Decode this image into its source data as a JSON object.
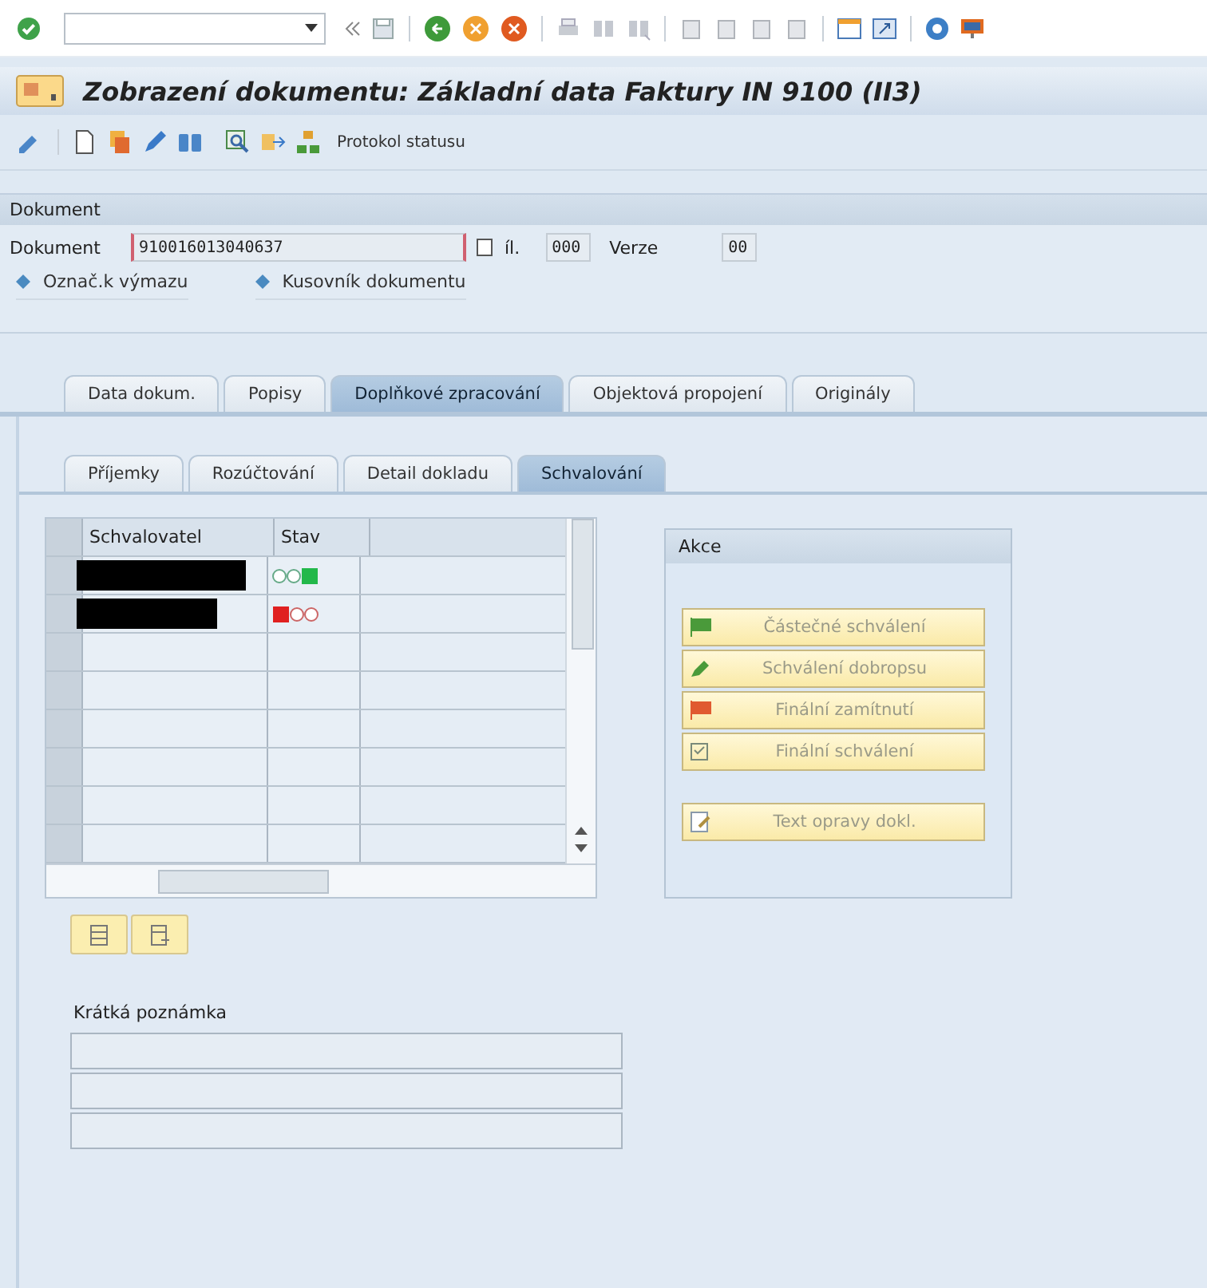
{
  "window": {
    "title": "Zobrazení dokumentu: Základní data Faktury IN 9100 (II3)"
  },
  "app_toolbar": {
    "button": "Protokol statusu"
  },
  "document": {
    "section_title": "Dokument",
    "field_label": "Dokument",
    "field_value": "910016013040637",
    "part_label": "íl.",
    "part_value": "000",
    "version_label": "Verze",
    "version_value": "00",
    "links": [
      "Označ.k výmazu",
      "Kusovník dokumentu"
    ]
  },
  "tabs": [
    {
      "label": "Data dokum.",
      "selected": false
    },
    {
      "label": "Popisy",
      "selected": false
    },
    {
      "label": "Doplňkové zpracování",
      "selected": true
    },
    {
      "label": "Objektová propojení",
      "selected": false
    },
    {
      "label": "Originály",
      "selected": false
    }
  ],
  "subtabs": [
    {
      "label": "Příjemky",
      "selected": false
    },
    {
      "label": "Rozúčtování",
      "selected": false
    },
    {
      "label": "Detail dokladu",
      "selected": false
    },
    {
      "label": "Schvalování",
      "selected": true
    }
  ],
  "approvers": {
    "columns": [
      "Schvalovatel",
      "Stav"
    ],
    "rows": [
      {
        "kind": "go",
        "color": "#22b84a"
      },
      {
        "kind": "stop",
        "color": "#e02020"
      }
    ]
  },
  "actions": {
    "title": "Akce",
    "buttons": [
      {
        "label": "Částečné schválení",
        "kind": "flag",
        "color": "#4a9a3a",
        "disabled": true
      },
      {
        "label": "Schválení dobropsu",
        "kind": "pencil",
        "color": "#4a9a3a",
        "disabled": true
      },
      {
        "label": "Finální zamítnutí",
        "kind": "flag",
        "color": "#e05a30",
        "disabled": true
      },
      {
        "label": "Finální schválení",
        "kind": "sheet",
        "color": "#7a8a7a",
        "disabled": true
      },
      {
        "label": "Text opravy dokl.",
        "kind": "note",
        "color": "#8a9aaa",
        "disabled": true
      }
    ]
  },
  "note": {
    "label": "Krátká poznámka"
  }
}
